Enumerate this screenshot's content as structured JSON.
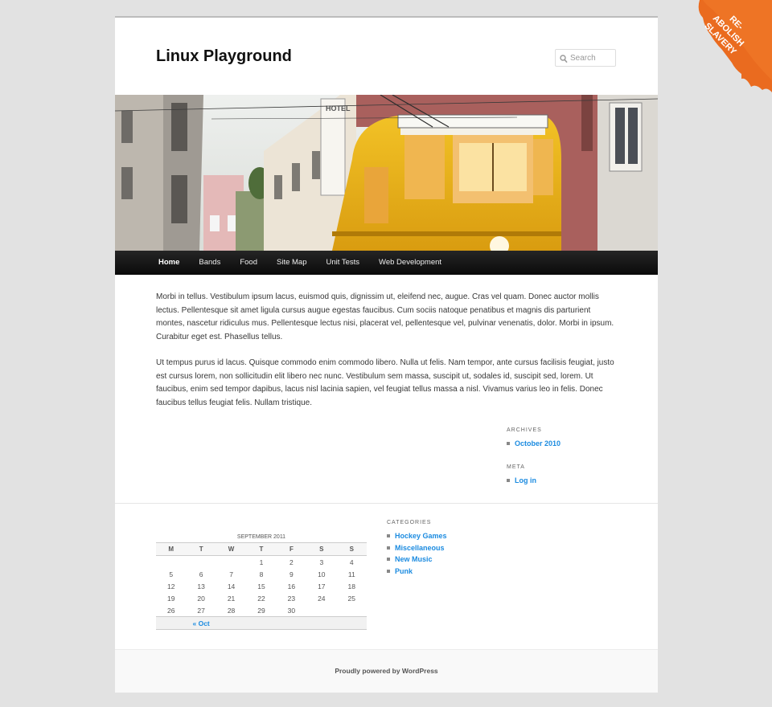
{
  "site": {
    "title": "Linux Playground"
  },
  "search": {
    "placeholder": "Search"
  },
  "ribbon": {
    "line1": "RE-",
    "line2": "ABOLISH",
    "line3": "SLAVERY",
    "color": "#ea6b1f"
  },
  "nav": {
    "items": [
      "Home",
      "Bands",
      "Food",
      "Site Map",
      "Unit Tests",
      "Web Development"
    ],
    "current": "Home"
  },
  "header_image": {
    "description": "yellow tram in a narrow street",
    "tram_color": "#e8b418"
  },
  "content": {
    "paragraphs": [
      "Morbi in tellus. Vestibulum ipsum lacus, euismod quis, dignissim ut, eleifend nec, augue. Cras vel quam. Donec auctor mollis lectus. Pellentesque sit amet ligula cursus augue egestas faucibus. Cum sociis natoque penatibus et magnis dis parturient montes, nascetur ridiculus mus. Pellentesque lectus nisi, placerat vel, pellentesque vel, pulvinar venenatis, dolor. Morbi in ipsum. Curabitur eget est. Phasellus tellus.",
      "Ut tempus purus id lacus. Quisque commodo enim commodo libero. Nulla ut felis. Nam tempor, ante cursus facilisis feugiat, justo est cursus lorem, non sollicitudin elit libero nec nunc. Vestibulum sem massa, suscipit ut, sodales id, suscipit sed, lorem. Ut faucibus, enim sed tempor dapibus, lacus nisl lacinia sapien, vel feugiat tellus massa a nisl. Vivamus varius leo in felis. Donec faucibus tellus feugiat felis. Nullam tristique."
    ]
  },
  "sidebar": {
    "archives": {
      "title": "ARCHIVES",
      "items": [
        "October 2010"
      ]
    },
    "meta": {
      "title": "META",
      "items": [
        "Log in"
      ]
    }
  },
  "calendar": {
    "caption": "SEPTEMBER 2011",
    "headers": [
      "M",
      "T",
      "W",
      "T",
      "F",
      "S",
      "S"
    ],
    "weeks": [
      [
        "",
        "",
        "",
        "1",
        "2",
        "3",
        "4"
      ],
      [
        "5",
        "6",
        "7",
        "8",
        "9",
        "10",
        "11"
      ],
      [
        "12",
        "13",
        "14",
        "15",
        "16",
        "17",
        "18"
      ],
      [
        "19",
        "20",
        "21",
        "22",
        "23",
        "24",
        "25"
      ],
      [
        "26",
        "27",
        "28",
        "29",
        "30",
        "",
        ""
      ]
    ],
    "prev": "« Oct"
  },
  "categories": {
    "title": "CATEGORIES",
    "items": [
      "Hockey Games",
      "Miscellaneous",
      "New Music",
      "Punk"
    ]
  },
  "footer": {
    "text": "Proudly powered by WordPress"
  },
  "colors": {
    "link": "#1b8be0",
    "page_bg": "#e2e2e2",
    "nav_bg": "#1a1a1a"
  }
}
